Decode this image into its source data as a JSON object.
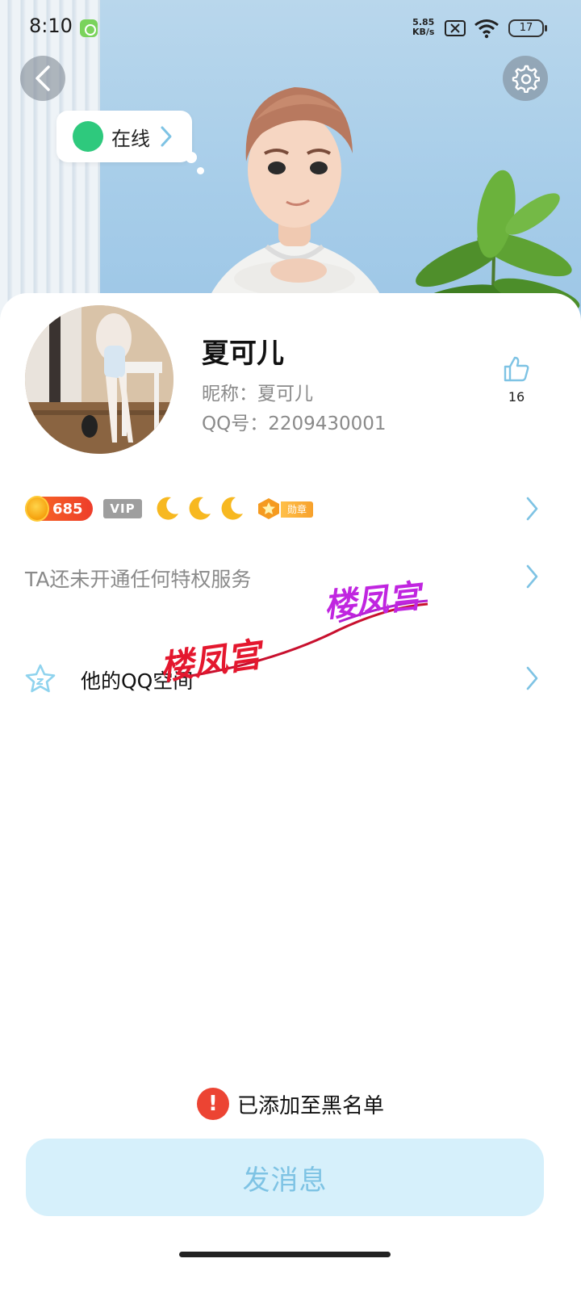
{
  "status_bar": {
    "time": "8:10",
    "net_speed_value": "5.85",
    "net_speed_unit": "KB/s",
    "battery": "17",
    "icons": [
      "app-notification-icon",
      "sim-off-icon",
      "wifi-icon",
      "battery-icon"
    ]
  },
  "header": {
    "back_icon": "chevron-left-icon",
    "settings_icon": "gear-icon",
    "online_status": "在线",
    "online_dot_color": "#2ec97d"
  },
  "profile": {
    "name": "夏可儿",
    "nickname": "昵称：夏可儿",
    "qq_number": "QQ号：2209430001",
    "likes": "16",
    "like_icon": "thumbs-up-icon"
  },
  "badges": {
    "coin_value": "685",
    "vip_label": "VIP",
    "moon_count": 3,
    "medal_label": "勋章"
  },
  "privilege": {
    "text": "TA还未开通任何特权服务"
  },
  "space": {
    "label": "他的QQ空间",
    "icon": "star-icon"
  },
  "watermark": {
    "text_1": "楼凤宫",
    "text_2": "楼凤宫"
  },
  "bottom": {
    "blacklist_notice": "已添加至黑名单",
    "alert_icon": "exclamation-icon",
    "send_message": "发消息"
  },
  "colors": {
    "accent": "#7ec3e4",
    "button_bg": "#d6f0fb",
    "alert": "#ec4433"
  }
}
